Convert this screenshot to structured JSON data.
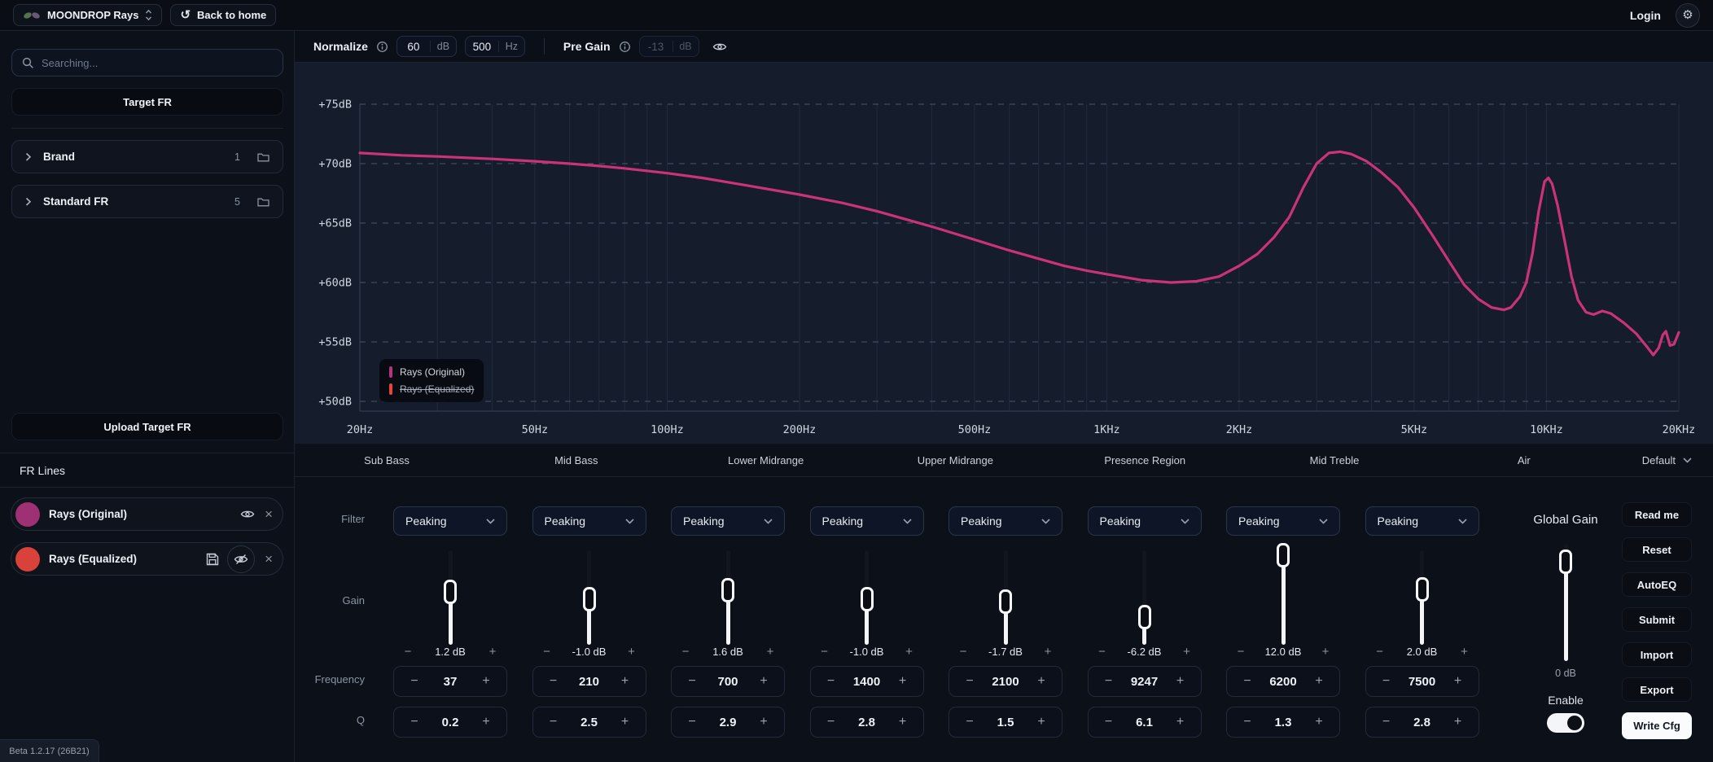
{
  "topbar": {
    "device_selector": "MOONDROP Rays",
    "back_button": "Back to home",
    "login": "Login"
  },
  "sidebar": {
    "search_placeholder": "Searching...",
    "target_fr_button": "Target FR",
    "groups": [
      {
        "label": "Brand",
        "count": "1"
      },
      {
        "label": "Standard FR",
        "count": "5"
      }
    ],
    "upload_button": "Upload Target FR",
    "fr_lines": {
      "header": "FR Lines",
      "items": [
        {
          "name": "Rays (Original)",
          "color": "#9e3173",
          "visible": true
        },
        {
          "name": "Rays (Equalized)",
          "color": "#d8423a",
          "visible": false
        }
      ]
    }
  },
  "controls": {
    "normalize_label": "Normalize",
    "normalize_db": "60",
    "normalize_db_unit": "dB",
    "normalize_hz": "500",
    "normalize_hz_unit": "Hz",
    "pregain_label": "Pre Gain",
    "pregain_value": "-13",
    "pregain_unit": "dB"
  },
  "chart_data": {
    "type": "line",
    "x_scale": "log",
    "x_range_hz": [
      20,
      20000
    ],
    "y_range_db": [
      50,
      75
    ],
    "grid": true,
    "x_ticks": [
      {
        "f": 20,
        "label": "20Hz"
      },
      {
        "f": 50,
        "label": "50Hz"
      },
      {
        "f": 100,
        "label": "100Hz"
      },
      {
        "f": 200,
        "label": "200Hz"
      },
      {
        "f": 500,
        "label": "500Hz"
      },
      {
        "f": 1000,
        "label": "1KHz"
      },
      {
        "f": 2000,
        "label": "2KHz"
      },
      {
        "f": 5000,
        "label": "5KHz"
      },
      {
        "f": 10000,
        "label": "10KHz"
      },
      {
        "f": 20000,
        "label": "20KHz"
      }
    ],
    "y_ticks": [
      {
        "db": 75,
        "label": "+75dB"
      },
      {
        "db": 70,
        "label": "+70dB"
      },
      {
        "db": 65,
        "label": "+65dB"
      },
      {
        "db": 60,
        "label": "+60dB"
      },
      {
        "db": 55,
        "label": "+55dB"
      },
      {
        "db": 50,
        "label": "+50dB"
      }
    ],
    "legend": [
      {
        "label": "Rays (Original)",
        "color": "#b0367f",
        "struck": false
      },
      {
        "label": "Rays (Equalized)",
        "color": "#e8453a",
        "struck": true
      }
    ],
    "series": [
      {
        "name": "Rays (Original)",
        "color": "#cb3379",
        "points": [
          [
            20,
            70.9
          ],
          [
            25,
            70.7
          ],
          [
            30,
            70.6
          ],
          [
            40,
            70.4
          ],
          [
            50,
            70.2
          ],
          [
            60,
            70.0
          ],
          [
            70,
            69.8
          ],
          [
            80,
            69.6
          ],
          [
            100,
            69.2
          ],
          [
            120,
            68.8
          ],
          [
            150,
            68.2
          ],
          [
            200,
            67.4
          ],
          [
            250,
            66.7
          ],
          [
            300,
            66.0
          ],
          [
            350,
            65.3
          ],
          [
            400,
            64.7
          ],
          [
            500,
            63.6
          ],
          [
            600,
            62.7
          ],
          [
            700,
            62.0
          ],
          [
            800,
            61.4
          ],
          [
            900,
            61.0
          ],
          [
            1000,
            60.7
          ],
          [
            1200,
            60.2
          ],
          [
            1400,
            60.0
          ],
          [
            1600,
            60.1
          ],
          [
            1800,
            60.5
          ],
          [
            2000,
            61.4
          ],
          [
            2200,
            62.4
          ],
          [
            2400,
            63.8
          ],
          [
            2600,
            65.5
          ],
          [
            2800,
            68.0
          ],
          [
            3000,
            70.0
          ],
          [
            3200,
            70.9
          ],
          [
            3400,
            71.0
          ],
          [
            3600,
            70.8
          ],
          [
            3900,
            70.2
          ],
          [
            4200,
            69.3
          ],
          [
            4600,
            68.0
          ],
          [
            5000,
            66.3
          ],
          [
            5500,
            64.0
          ],
          [
            6000,
            61.8
          ],
          [
            6500,
            59.8
          ],
          [
            7000,
            58.6
          ],
          [
            7500,
            57.9
          ],
          [
            8000,
            57.7
          ],
          [
            8300,
            57.9
          ],
          [
            8700,
            58.8
          ],
          [
            9000,
            60.0
          ],
          [
            9300,
            62.5
          ],
          [
            9600,
            66.0
          ],
          [
            9900,
            68.5
          ],
          [
            10100,
            68.8
          ],
          [
            10300,
            68.3
          ],
          [
            10600,
            66.5
          ],
          [
            11000,
            63.5
          ],
          [
            11400,
            60.5
          ],
          [
            11800,
            58.5
          ],
          [
            12300,
            57.5
          ],
          [
            12800,
            57.3
          ],
          [
            13400,
            57.6
          ],
          [
            14000,
            57.4
          ],
          [
            15000,
            56.6
          ],
          [
            16000,
            55.7
          ],
          [
            17000,
            54.5
          ],
          [
            17500,
            53.9
          ],
          [
            18000,
            54.5
          ],
          [
            18400,
            55.6
          ],
          [
            18700,
            55.9
          ],
          [
            19100,
            54.7
          ],
          [
            19500,
            54.8
          ],
          [
            20000,
            55.8
          ]
        ]
      }
    ]
  },
  "bands": {
    "items": [
      "Sub Bass",
      "Mid Bass",
      "Lower Midrange",
      "Upper Midrange",
      "Presence Region",
      "Mid Treble",
      "Air"
    ],
    "preset": "Default"
  },
  "eq": {
    "row_labels": {
      "filter": "Filter",
      "gain": "Gain",
      "frequency": "Frequency",
      "q": "Q"
    },
    "slider_range_db": [
      -12,
      12
    ],
    "filters": [
      {
        "filter": "Peaking",
        "gain_db": 1.2,
        "gain_label": "1.2 dB",
        "frequency": "37",
        "q": "0.2"
      },
      {
        "filter": "Peaking",
        "gain_db": -1.0,
        "gain_label": "-1.0 dB",
        "frequency": "210",
        "q": "2.5"
      },
      {
        "filter": "Peaking",
        "gain_db": 1.6,
        "gain_label": "1.6 dB",
        "frequency": "700",
        "q": "2.9"
      },
      {
        "filter": "Peaking",
        "gain_db": -1.0,
        "gain_label": "-1.0 dB",
        "frequency": "1400",
        "q": "2.8"
      },
      {
        "filter": "Peaking",
        "gain_db": -1.7,
        "gain_label": "-1.7 dB",
        "frequency": "2100",
        "q": "1.5"
      },
      {
        "filter": "Peaking",
        "gain_db": -6.2,
        "gain_label": "-6.2 dB",
        "frequency": "9247",
        "q": "6.1"
      },
      {
        "filter": "Peaking",
        "gain_db": 12.0,
        "gain_label": "12.0 dB",
        "frequency": "6200",
        "q": "1.3"
      },
      {
        "filter": "Peaking",
        "gain_db": 2.0,
        "gain_label": "2.0 dB",
        "frequency": "7500",
        "q": "2.8"
      }
    ],
    "global": {
      "label": "Global Gain",
      "value_label": "0 dB",
      "enable_label": "Enable",
      "enabled": true
    }
  },
  "actions": [
    {
      "label": "Read me"
    },
    {
      "label": "Reset"
    },
    {
      "label": "AutoEQ"
    },
    {
      "label": "Submit"
    },
    {
      "label": "Import"
    },
    {
      "label": "Export"
    },
    {
      "label": "Write Cfg",
      "primary": true
    }
  ],
  "footer": {
    "version": "Beta 1.2.17 (26B21)"
  }
}
